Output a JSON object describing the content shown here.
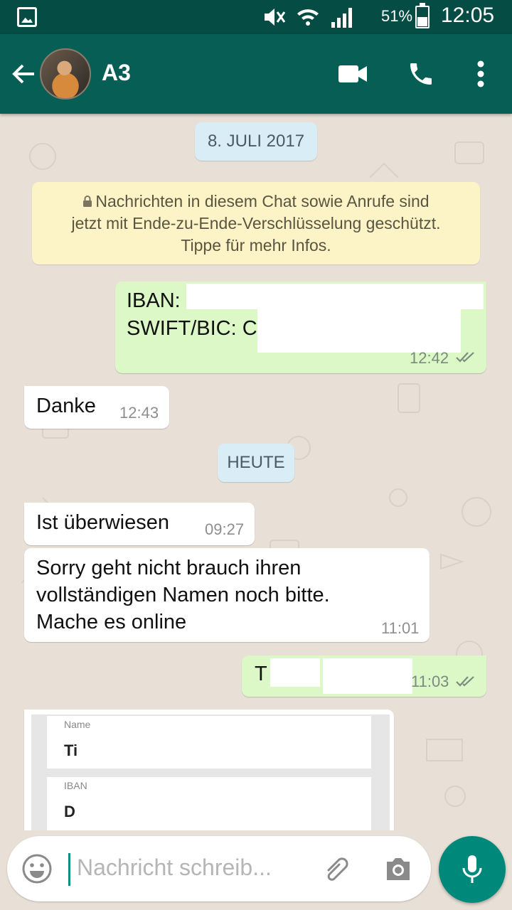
{
  "status_bar": {
    "battery": "51%",
    "time": "12:05"
  },
  "header": {
    "contact_name": "A3"
  },
  "chat": {
    "date_1": "8. JULI 2017",
    "encryption_notice": [
      "Nachrichten in diesem Chat sowie Anrufe sind",
      "jetzt mit Ende-zu-Ende-Verschlüsselung geschützt.",
      "Tippe für mehr Infos."
    ],
    "messages": [
      {
        "dir": "out",
        "lines": [
          "IBAN:",
          "SWIFT/BIC: C"
        ],
        "time": "12:42",
        "status": "read"
      },
      {
        "dir": "in",
        "text": "Danke",
        "time": "12:43"
      },
      {
        "dir": "in",
        "text": "Ist überwiesen",
        "time": "09:27"
      },
      {
        "dir": "in",
        "lines": [
          "Sorry geht nicht brauch ihren",
          "vollständigen Namen noch bitte.",
          "Mache es online"
        ],
        "time": "11:01"
      },
      {
        "dir": "out",
        "text": "T",
        "time": "11:03",
        "status": "read"
      }
    ],
    "date_2": "HEUTE",
    "screenshot_form": {
      "name_label": "Name",
      "name_value": "Ti",
      "iban_label": "IBAN",
      "iban_value": "D"
    }
  },
  "input": {
    "placeholder": "Nachricht schreib..."
  },
  "colors": {
    "status_bar": "#054d44",
    "app_bar": "#075e54",
    "outgoing_bubble": "#dcf8c6",
    "incoming_bubble": "#ffffff",
    "read_ticks": "#4fc3f7",
    "mic_button": "#00897b"
  },
  "icons": [
    "gallery-icon",
    "mute-icon",
    "wifi-icon",
    "signal-icon",
    "battery-icon",
    "back-arrow-icon",
    "video-call-icon",
    "phone-icon",
    "more-vert-icon",
    "lock-icon",
    "double-check-icon",
    "emoji-icon",
    "attach-icon",
    "camera-icon",
    "mic-icon"
  ]
}
